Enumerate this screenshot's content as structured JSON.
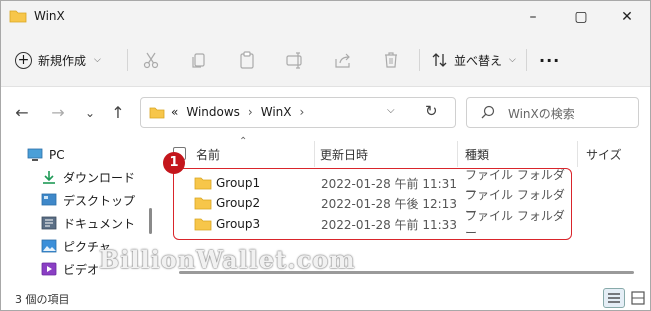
{
  "window": {
    "title": "WinX"
  },
  "toolbar": {
    "new_label": "新規作成",
    "sort_label": "並べ替え",
    "more_label": "..."
  },
  "address": {
    "overflow": "«",
    "crumbs": [
      "Windows",
      "WinX"
    ],
    "search_placeholder": "WinXの検索"
  },
  "nav": {
    "items": [
      {
        "label": "PC",
        "icon": "pc-icon"
      },
      {
        "label": "ダウンロード",
        "icon": "download-icon"
      },
      {
        "label": "デスクトップ",
        "icon": "desktop-icon"
      },
      {
        "label": "ドキュメント",
        "icon": "documents-icon"
      },
      {
        "label": "ピクチャ",
        "icon": "pictures-icon"
      },
      {
        "label": "ビデオ",
        "icon": "videos-icon"
      }
    ]
  },
  "columns": {
    "name": "名前",
    "date": "更新日時",
    "type": "種類",
    "size": "サイズ"
  },
  "files": [
    {
      "name": "Group1",
      "date": "2022-01-28 午前 11:31",
      "type": "ファイル フォルダー"
    },
    {
      "name": "Group2",
      "date": "2022-01-28 午後 12:13",
      "type": "ファイル フォルダー"
    },
    {
      "name": "Group3",
      "date": "2022-01-28 午前 11:33",
      "type": "ファイル フォルダー"
    }
  ],
  "annotation": {
    "badge": "1"
  },
  "watermark": "BillionWallet.com",
  "status": {
    "count": "3 個の項目"
  },
  "colors": {
    "folder": "#f7c64a",
    "accent": "#0067c0",
    "highlight_border": "#d9252b"
  }
}
